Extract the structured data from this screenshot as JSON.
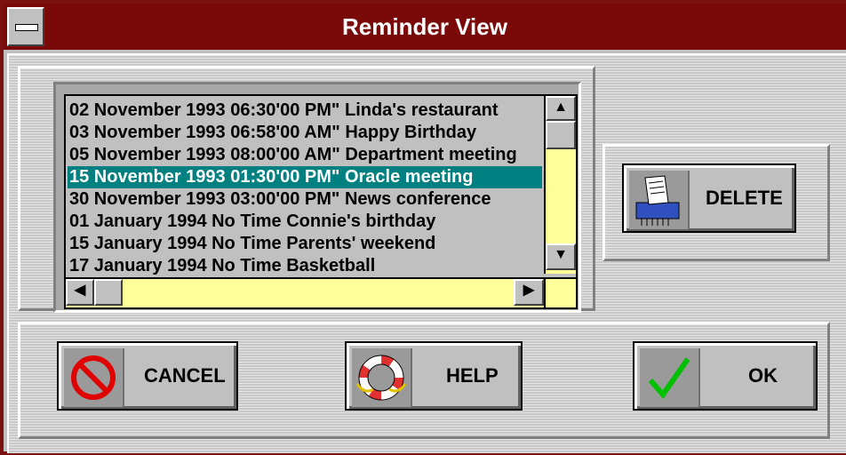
{
  "window": {
    "title": "Reminder View"
  },
  "reminders": {
    "items": [
      "02 November 1993 06:30'00 PM\" Linda's restaurant",
      "03 November 1993 06:58'00 AM\" Happy Birthday",
      "05 November 1993 08:00'00 AM\" Department meeting",
      "15 November 1993 01:30'00 PM\" Oracle meeting",
      "30 November 1993 03:00'00 PM\" News conference",
      "01 January 1994 No Time Connie's birthday",
      "15 January 1994 No Time Parents' weekend",
      "17 January 1994 No Time Basketball"
    ],
    "selected_index": 3
  },
  "buttons": {
    "delete": "DELETE",
    "cancel": "CANCEL",
    "help": "HELP",
    "ok": "OK"
  },
  "icons": {
    "sysmenu": "system-menu-icon",
    "delete": "shredder-icon",
    "cancel": "no-sign-icon",
    "help": "life-ring-icon",
    "ok": "checkmark-icon"
  }
}
